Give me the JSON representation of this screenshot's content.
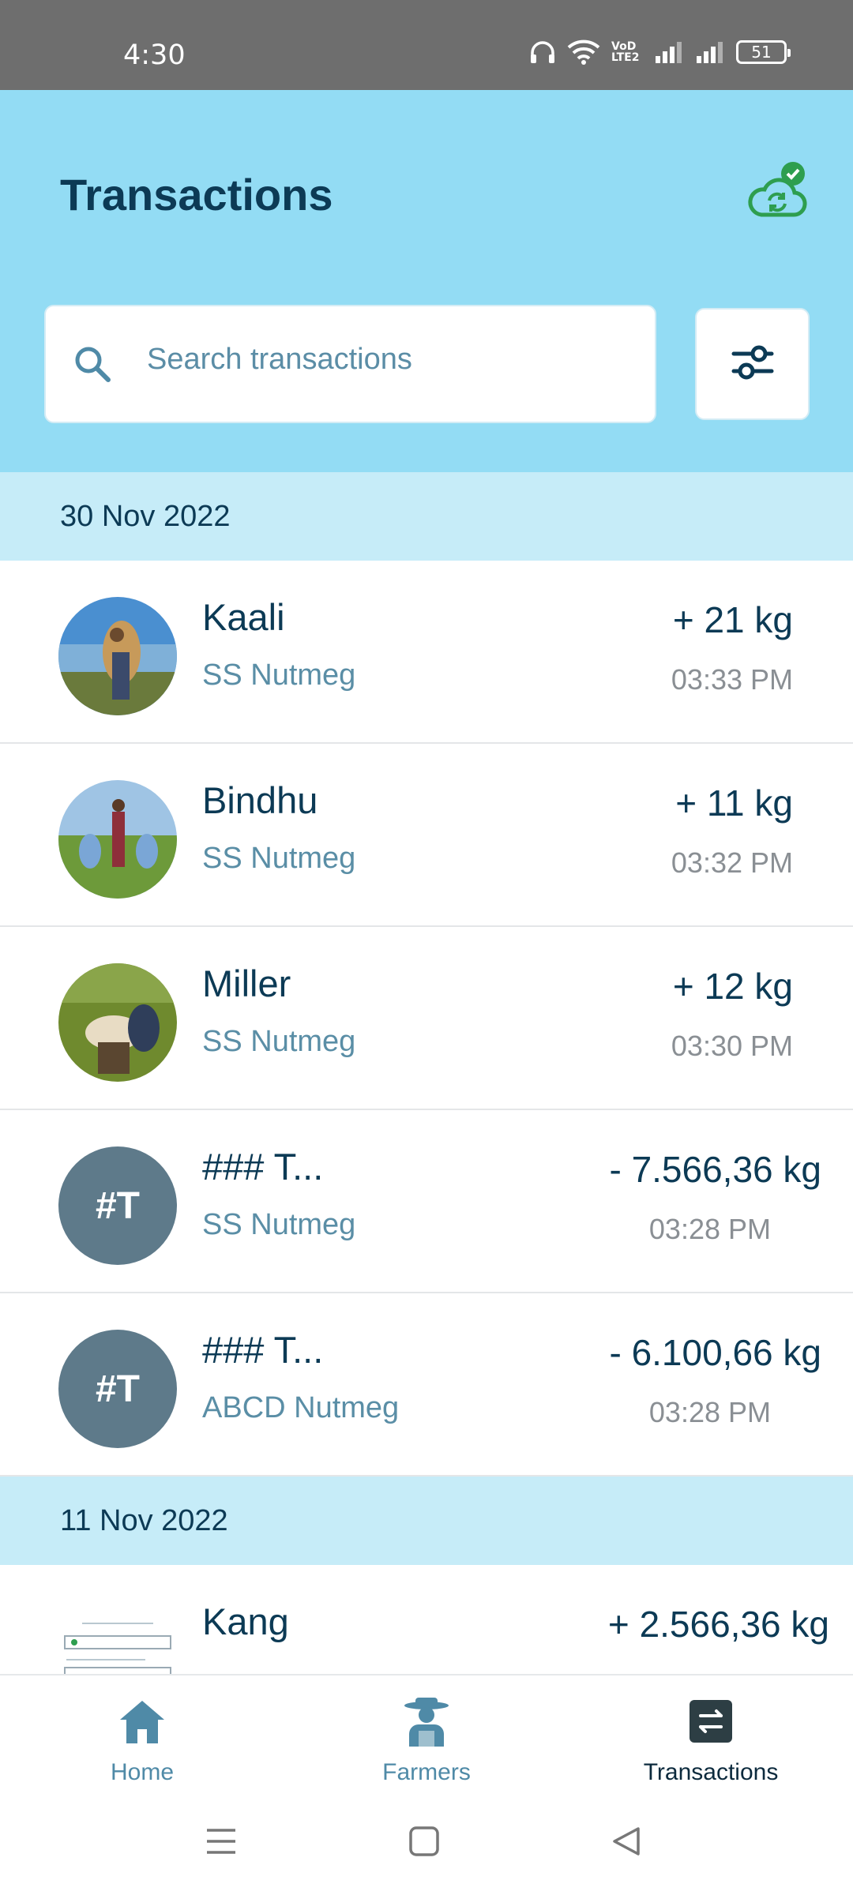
{
  "status_bar": {
    "time": "4:30",
    "network_label": "VoD LTE2",
    "battery": "51"
  },
  "header": {
    "title": "Transactions",
    "sync_icon": "cloud-sync-check-icon",
    "search": {
      "placeholder": "Search transactions",
      "icon": "search-icon"
    },
    "filter_icon": "sliders-icon"
  },
  "sections": [
    {
      "date": "30 Nov 2022",
      "rows": [
        {
          "name": "Kaali",
          "product": "SS Nutmeg",
          "amount": "+ 21 kg",
          "time": "03:33 PM",
          "avatar": "photo"
        },
        {
          "name": "Bindhu",
          "product": "SS Nutmeg",
          "amount": "+ 11 kg",
          "time": "03:32 PM",
          "avatar": "photo"
        },
        {
          "name": "Miller",
          "product": "SS Nutmeg",
          "amount": "+ 12 kg",
          "time": "03:30 PM",
          "avatar": "photo"
        },
        {
          "name": "### T...",
          "product": "SS Nutmeg",
          "amount": "- 7.566,36 kg",
          "time": "03:28 PM",
          "avatar": "#T"
        },
        {
          "name": "### T...",
          "product": "ABCD Nutmeg",
          "amount": "- 6.100,66 kg",
          "time": "03:28 PM",
          "avatar": "#T"
        }
      ]
    },
    {
      "date": "11 Nov 2022",
      "rows": [
        {
          "name": "Kang",
          "amount": "+ 2.566,36 kg",
          "avatar": "document"
        }
      ]
    }
  ],
  "bottom_nav": [
    {
      "label": "Home",
      "icon": "home-icon",
      "active": false
    },
    {
      "label": "Farmers",
      "icon": "farmer-icon",
      "active": false
    },
    {
      "label": "Transactions",
      "icon": "transactions-icon",
      "active": true
    }
  ],
  "system_nav": [
    "menu-icon",
    "square-icon",
    "back-icon"
  ],
  "colors": {
    "header_bg": "#93dcf4",
    "date_header_bg": "#c6ecf8",
    "text_primary": "#0c3a55",
    "text_secondary": "#5a8ea6",
    "sync_green": "#2e9e4f",
    "avatar_initials_bg": "#5e7a8a"
  }
}
